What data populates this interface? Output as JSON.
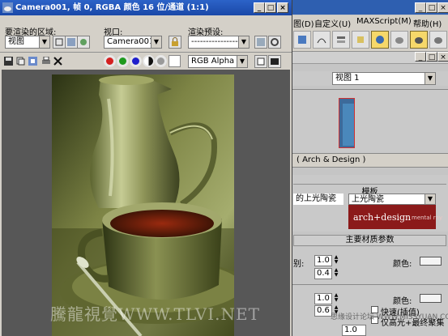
{
  "render_frame": {
    "title": "Camera001, 帧 0, RGBA 颜色 16 位/通道 (1:1)",
    "area_label": "要渲染的区域:",
    "area_value": "视图",
    "viewport_label": "视口:",
    "viewport_value": "Camera001",
    "preset_label": "渲染预设:",
    "preset_value": "-------------------",
    "channel_value": "RGB Alpha",
    "icon_names": [
      "save-icon",
      "copy-icon",
      "clone-icon",
      "print-icon",
      "clear-icon"
    ],
    "channel_colors": {
      "red": "#e02020",
      "green": "#20a020",
      "blue": "#2020d0"
    }
  },
  "max_app": {
    "menu": [
      "图(D)",
      "自定义(U)",
      "MAXScript(M)",
      "帮助(H)"
    ],
    "viewport_combo": "视图 1",
    "material_name": "( Arch & Design )",
    "template_header": "模板",
    "template_left": "的上光陶瓷",
    "template_right": "上光陶瓷",
    "banner_brand": "arch+design",
    "banner_sub": "mental ray",
    "main_header": "主要材质参数",
    "row1_label": "别:",
    "row1_value": "1.0",
    "row2_value": "0.4",
    "row3_value": "1.0",
    "row4_value": "0.6",
    "color_label": "颜色:",
    "color_label2": "颜色:",
    "check1": "快速(插值)",
    "check2": "仅高光+最终聚集",
    "bottom_value": "1.0"
  },
  "watermark": {
    "main": "騰龍視覺WWW.TLVI.NET",
    "site": "思缘设计论坛 WWW.MISSYUAN.COM"
  }
}
